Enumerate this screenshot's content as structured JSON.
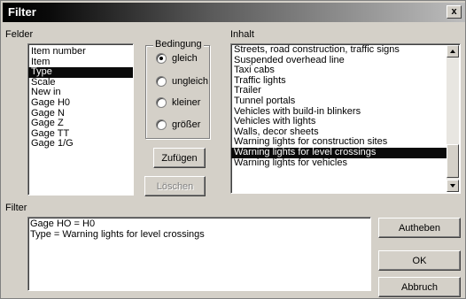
{
  "window": {
    "title": "Filter",
    "close_label": "x"
  },
  "felder": {
    "label": "Felder",
    "items": [
      {
        "label": "Item number",
        "selected": false
      },
      {
        "label": "Item",
        "selected": false
      },
      {
        "label": "Type",
        "selected": true
      },
      {
        "label": "Scale",
        "selected": false
      },
      {
        "label": "New in",
        "selected": false
      },
      {
        "label": "Gage H0",
        "selected": false
      },
      {
        "label": "Gage N",
        "selected": false
      },
      {
        "label": "Gage Z",
        "selected": false
      },
      {
        "label": "Gage TT",
        "selected": false
      },
      {
        "label": "Gage 1/G",
        "selected": false
      }
    ]
  },
  "bedingung": {
    "label": "Bedingung",
    "options": [
      {
        "label": "gleich",
        "selected": true
      },
      {
        "label": "ungleich",
        "selected": false
      },
      {
        "label": "kleiner",
        "selected": false
      },
      {
        "label": "größer",
        "selected": false
      }
    ]
  },
  "buttons": {
    "add": "Zufügen",
    "delete": "Löschen",
    "reset": "Autheben",
    "ok": "OK",
    "cancel": "Abbruch"
  },
  "inhalt": {
    "label": "Inhalt",
    "items": [
      {
        "label": "Streets, road construction, traffic signs",
        "selected": false
      },
      {
        "label": "Suspended overhead line",
        "selected": false
      },
      {
        "label": "Taxi cabs",
        "selected": false
      },
      {
        "label": "Traffic lights",
        "selected": false
      },
      {
        "label": "Trailer",
        "selected": false
      },
      {
        "label": "Tunnel portals",
        "selected": false
      },
      {
        "label": "Vehicles with build-in blinkers",
        "selected": false
      },
      {
        "label": "Vehicles with lights",
        "selected": false
      },
      {
        "label": "Walls, decor sheets",
        "selected": false
      },
      {
        "label": "Warning lights for construction sites",
        "selected": false
      },
      {
        "label": "Warning lights for level crossings",
        "selected": true
      },
      {
        "label": "Warning lights for vehicles",
        "selected": false
      }
    ]
  },
  "filter": {
    "label": "Filter",
    "lines": [
      "Gage HO = H0",
      "Type = Warning lights for level crossings"
    ]
  },
  "colors": {
    "selection": "#0a0a0a",
    "face": "#d4d0c8"
  },
  "icons": {
    "close": "close-icon",
    "scroll_up": "arrow-up-icon",
    "scroll_down": "arrow-down-icon"
  }
}
